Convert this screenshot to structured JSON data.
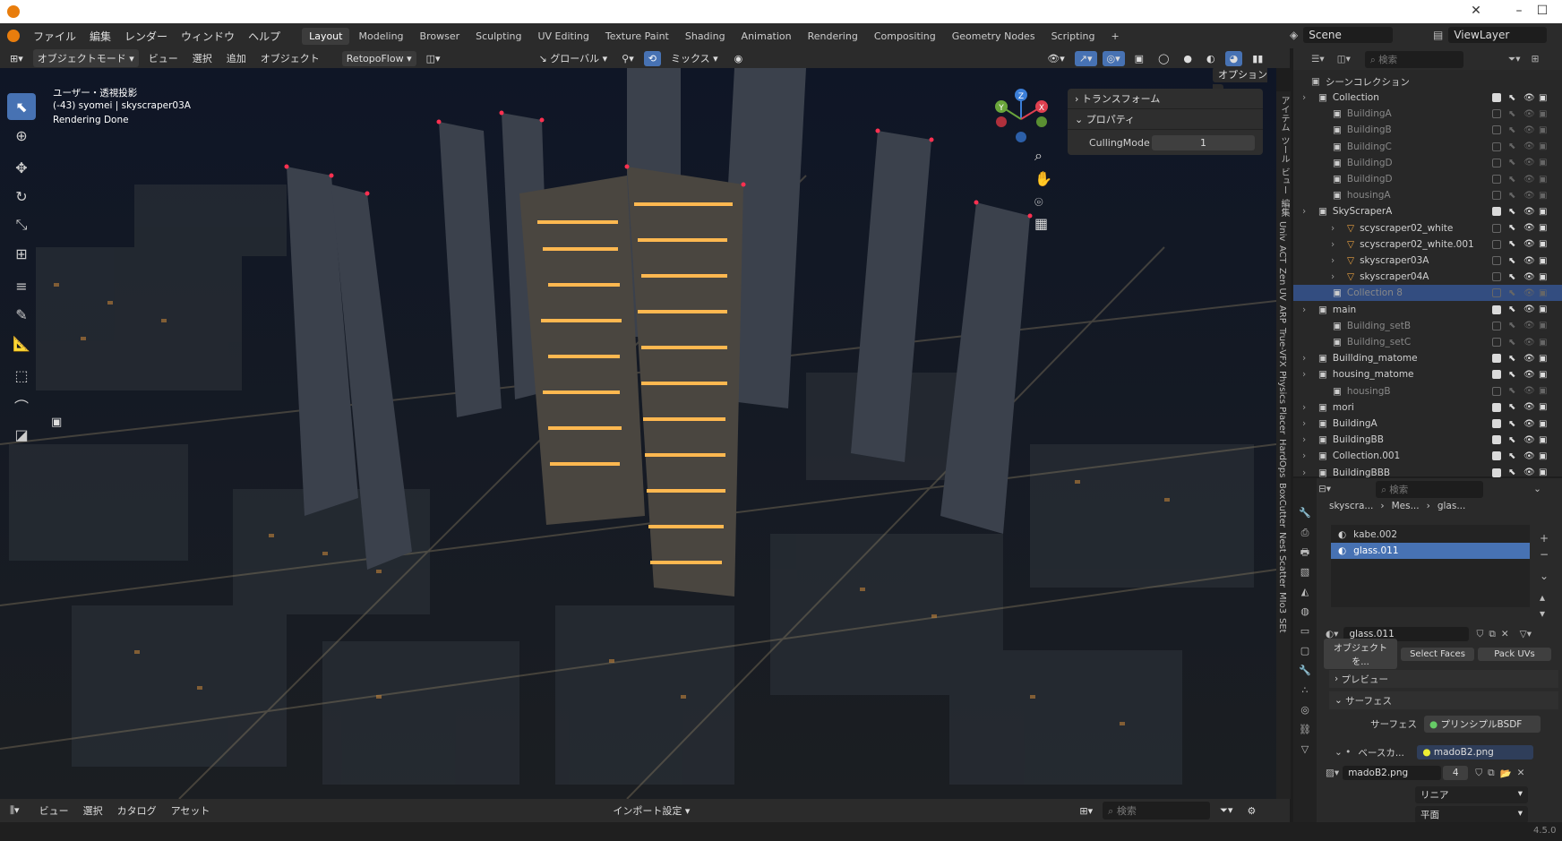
{
  "titlebar": {
    "menu": [
      "ファイル",
      "編集",
      "レンダー",
      "ウィンドウ",
      "ヘルプ"
    ]
  },
  "workspaces": [
    "Layout",
    "Modeling",
    "Browser",
    "Sculpting",
    "UV Editing",
    "Texture Paint",
    "Shading",
    "Animation",
    "Rendering",
    "Compositing",
    "Geometry Nodes",
    "Scripting"
  ],
  "add_workspace": "+",
  "scene": {
    "name": "Scene",
    "view_layer": "ViewLayer"
  },
  "viewport_header": {
    "mode": "オブジェクトモード",
    "menus": [
      "ビュー",
      "選択",
      "追加",
      "オブジェクト"
    ],
    "addon": "RetopoFlow",
    "orientation": "グローバル",
    "blend": "ミックス",
    "options": "オプション"
  },
  "viewport": {
    "line1": "ユーザー・透視投影",
    "line2": "(-43) syomei | skyscraper03A",
    "line3": "Rendering Done"
  },
  "gizmo": {
    "x": "X",
    "y": "Y",
    "z": "Z"
  },
  "npanel": {
    "transform": "トランスフォーム",
    "properties": "プロパティ",
    "culling_label": "CullingMode",
    "culling_value": "1"
  },
  "side_tabs": [
    "アイテム",
    "ツール",
    "ビュー",
    "編集",
    "Univ",
    "ACT",
    "Zen UV",
    "ARP",
    "True-VFX",
    "Physics Placer",
    "HardOps",
    "BoxCutter",
    "Nest Scatter",
    "MIo3",
    "SEt"
  ],
  "outliner": {
    "search_placeholder": "検索",
    "root": "シーンコレクション",
    "items": [
      {
        "name": "Collection",
        "level": 0,
        "check": true,
        "sel": false
      },
      {
        "name": "BuildingA",
        "level": 1,
        "check": false,
        "sel": false
      },
      {
        "name": "BuildingB",
        "level": 1,
        "check": false,
        "sel": false
      },
      {
        "name": "BuildingC",
        "level": 1,
        "check": false,
        "sel": false
      },
      {
        "name": "BuildingD",
        "level": 1,
        "check": false,
        "sel": false
      },
      {
        "name": "BuildingD",
        "level": 1,
        "check": false,
        "sel": false
      },
      {
        "name": "housingA",
        "level": 1,
        "check": false,
        "sel": false
      },
      {
        "name": "SkyScraperA",
        "level": 0,
        "check": true,
        "sel": false
      },
      {
        "name": "scyscraper02_white",
        "level": 2,
        "check": false,
        "sel": false
      },
      {
        "name": "scyscraper02_white.001",
        "level": 2,
        "check": false,
        "sel": false
      },
      {
        "name": "skyscraper03A",
        "level": 2,
        "check": false,
        "sel": false
      },
      {
        "name": "skyscraper04A",
        "level": 2,
        "check": false,
        "sel": false
      },
      {
        "name": "Collection 8",
        "level": 1,
        "check": false,
        "sel": true
      },
      {
        "name": "main",
        "level": 0,
        "check": true,
        "sel": false
      },
      {
        "name": "Building_setB",
        "level": 1,
        "check": false,
        "sel": false
      },
      {
        "name": "Building_setC",
        "level": 1,
        "check": false,
        "sel": false
      },
      {
        "name": "Buillding_matome",
        "level": 0,
        "check": true,
        "sel": false
      },
      {
        "name": "housing_matome",
        "level": 0,
        "check": true,
        "sel": false
      },
      {
        "name": "housingB",
        "level": 1,
        "check": false,
        "sel": false
      },
      {
        "name": "mori",
        "level": 0,
        "check": true,
        "sel": false
      },
      {
        "name": "BuildingA",
        "level": 0,
        "check": true,
        "sel": false
      },
      {
        "name": "BuildingBB",
        "level": 0,
        "check": true,
        "sel": false
      },
      {
        "name": "Collection.001",
        "level": 0,
        "check": true,
        "sel": false
      },
      {
        "name": "BuildingBBB",
        "level": 0,
        "check": true,
        "sel": false
      }
    ]
  },
  "properties": {
    "search_placeholder": "検索",
    "breadcrumb": [
      "skyscra...",
      "Mes...",
      "glas..."
    ],
    "slots": [
      "kabe.002",
      "glass.011"
    ],
    "material": "glass.011",
    "buttons": [
      "オブジェクトを...",
      "Select Faces",
      "Pack UVs"
    ],
    "preview": "プレビュー",
    "surface": "サーフェス",
    "surface_label": "サーフェス",
    "shader": "プリンシプルBSDF",
    "base_label": "ベースカ...",
    "base_tex": "madoB2.png",
    "image_name": "madoB2.png",
    "image_users": "4",
    "interp": "リニア",
    "proj": "平面"
  },
  "bottombar": {
    "menus": [
      "ビュー",
      "選択",
      "カタログ",
      "アセット"
    ],
    "import": "インポート設定",
    "search_placeholder": "検索"
  },
  "status": {
    "version": "4.5.0"
  }
}
